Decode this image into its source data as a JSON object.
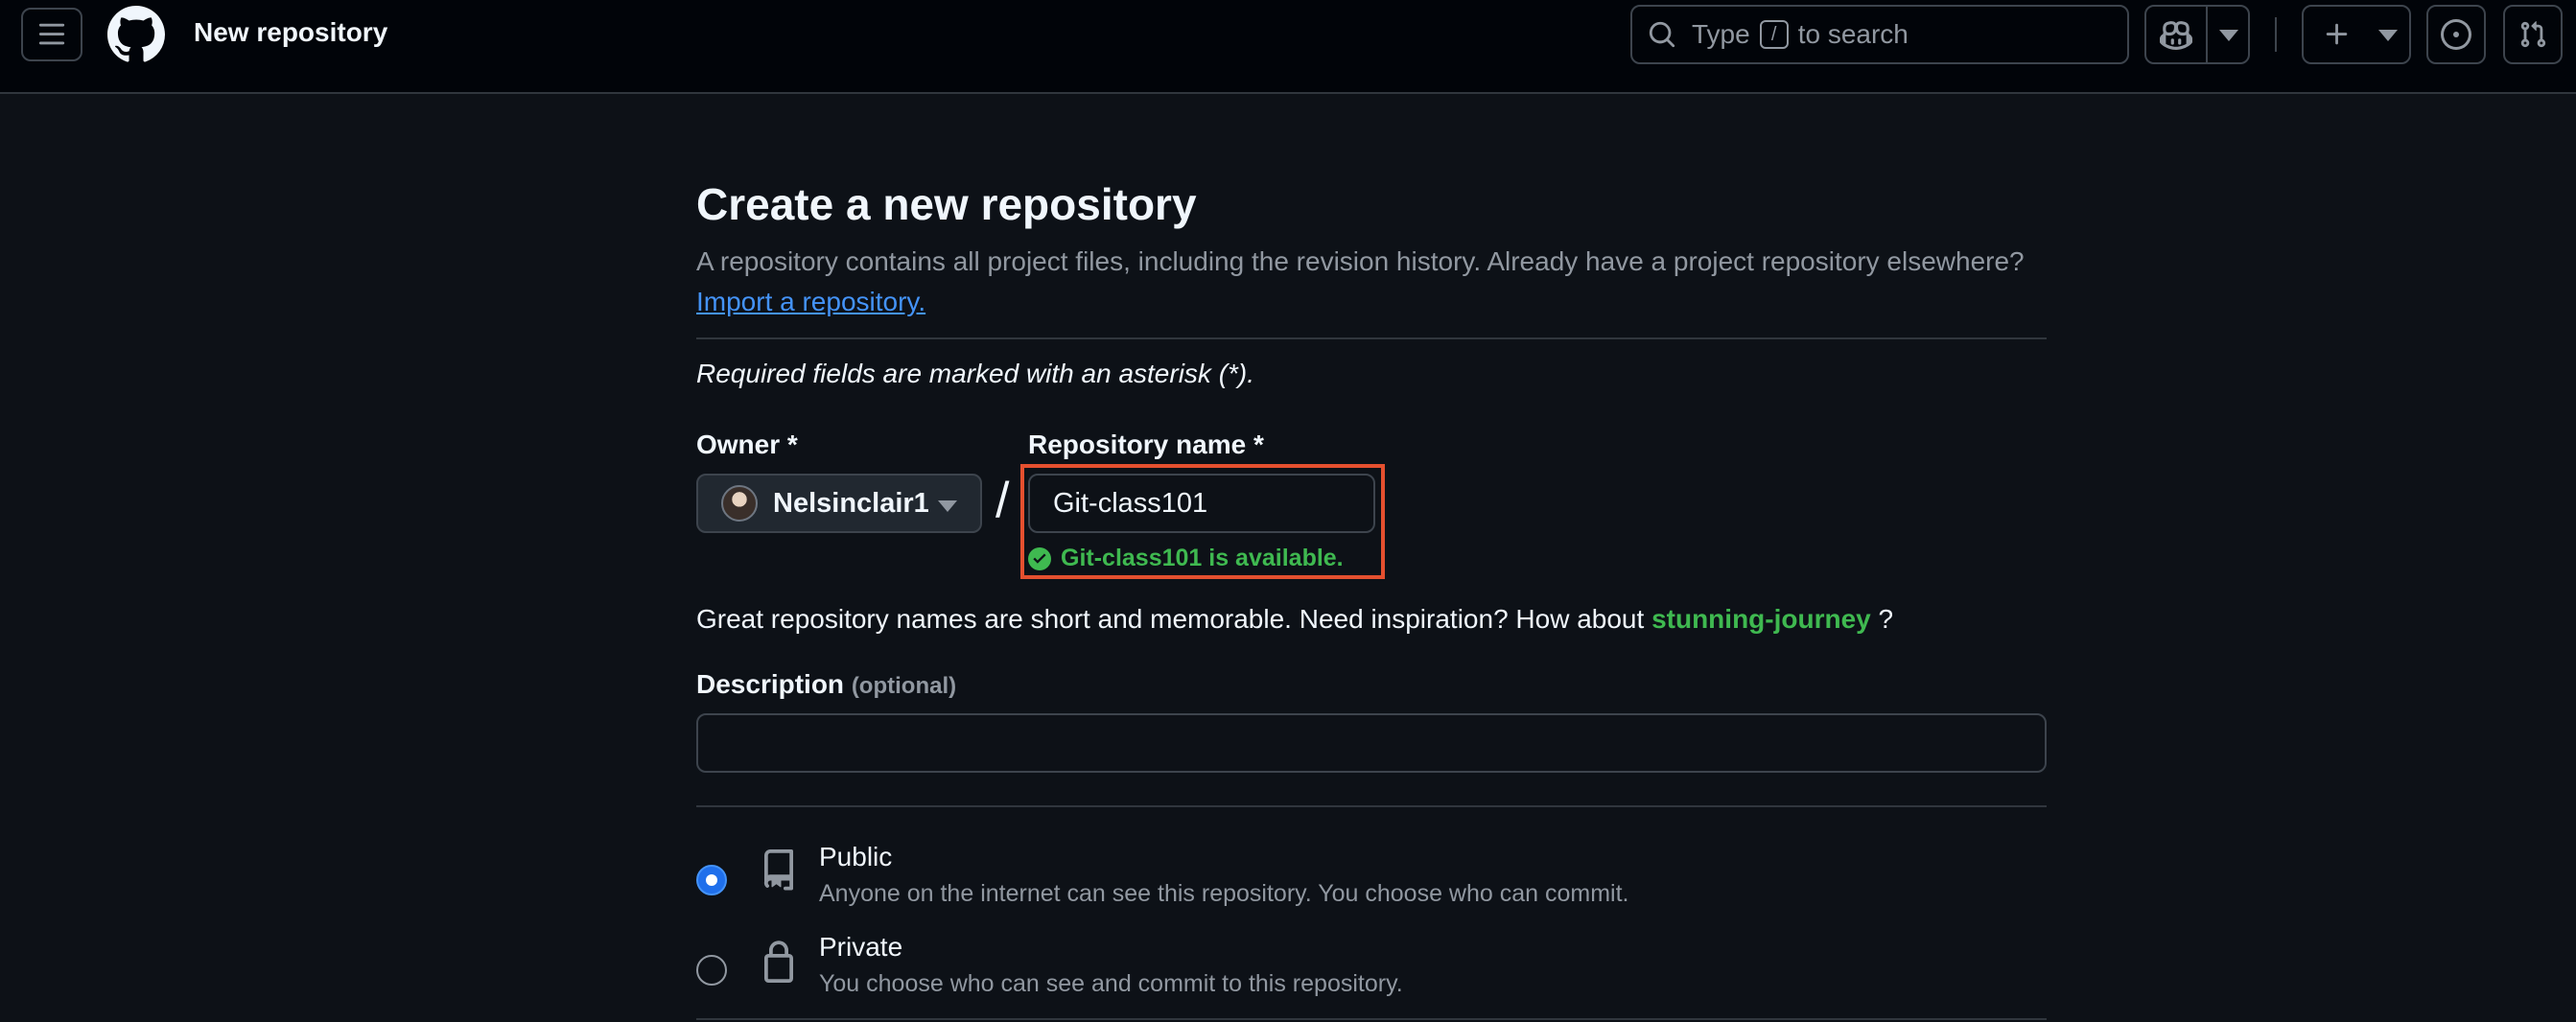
{
  "header": {
    "page_title": "New repository",
    "search": {
      "prefix": "Type",
      "key": "/",
      "suffix": "to search"
    }
  },
  "main": {
    "heading": "Create a new repository",
    "lead_text": "A repository contains all project files, including the revision history. Already have a project repository elsewhere?",
    "import_link": "Import a repository.",
    "required_note": "Required fields are marked with an asterisk (*).",
    "owner": {
      "label": "Owner *",
      "value": "Nelsinclair1"
    },
    "slash": "/",
    "repo_name": {
      "label": "Repository name *",
      "value": "Git-class101",
      "availability": "Git-class101 is available."
    },
    "inspiration": {
      "text": "Great repository names are short and memorable. Need inspiration? How about",
      "suggestion": "stunning-journey",
      "suffix": "?"
    },
    "description": {
      "label": "Description",
      "optional": "(optional)",
      "value": ""
    },
    "visibility": [
      {
        "title": "Public",
        "description": "Anyone on the internet can see this repository. You choose who can commit.",
        "selected": true
      },
      {
        "title": "Private",
        "description": "You choose who can see and commit to this repository.",
        "selected": false
      }
    ]
  },
  "colors": {
    "background": "#0d1117",
    "header_background": "#010409",
    "accent_blue": "#4493f8",
    "success_green": "#3fb950",
    "highlight_red": "#e5502f"
  },
  "icons": {
    "menu": "hamburger-icon",
    "logo": "github-logo",
    "search": "search-icon",
    "copilot": "copilot-icon",
    "create": "plus-icon",
    "issues": "issue-opened-icon",
    "pull_requests": "git-pull-request-icon",
    "public": "repo-icon",
    "private": "lock-icon",
    "available": "check-circle-icon"
  }
}
